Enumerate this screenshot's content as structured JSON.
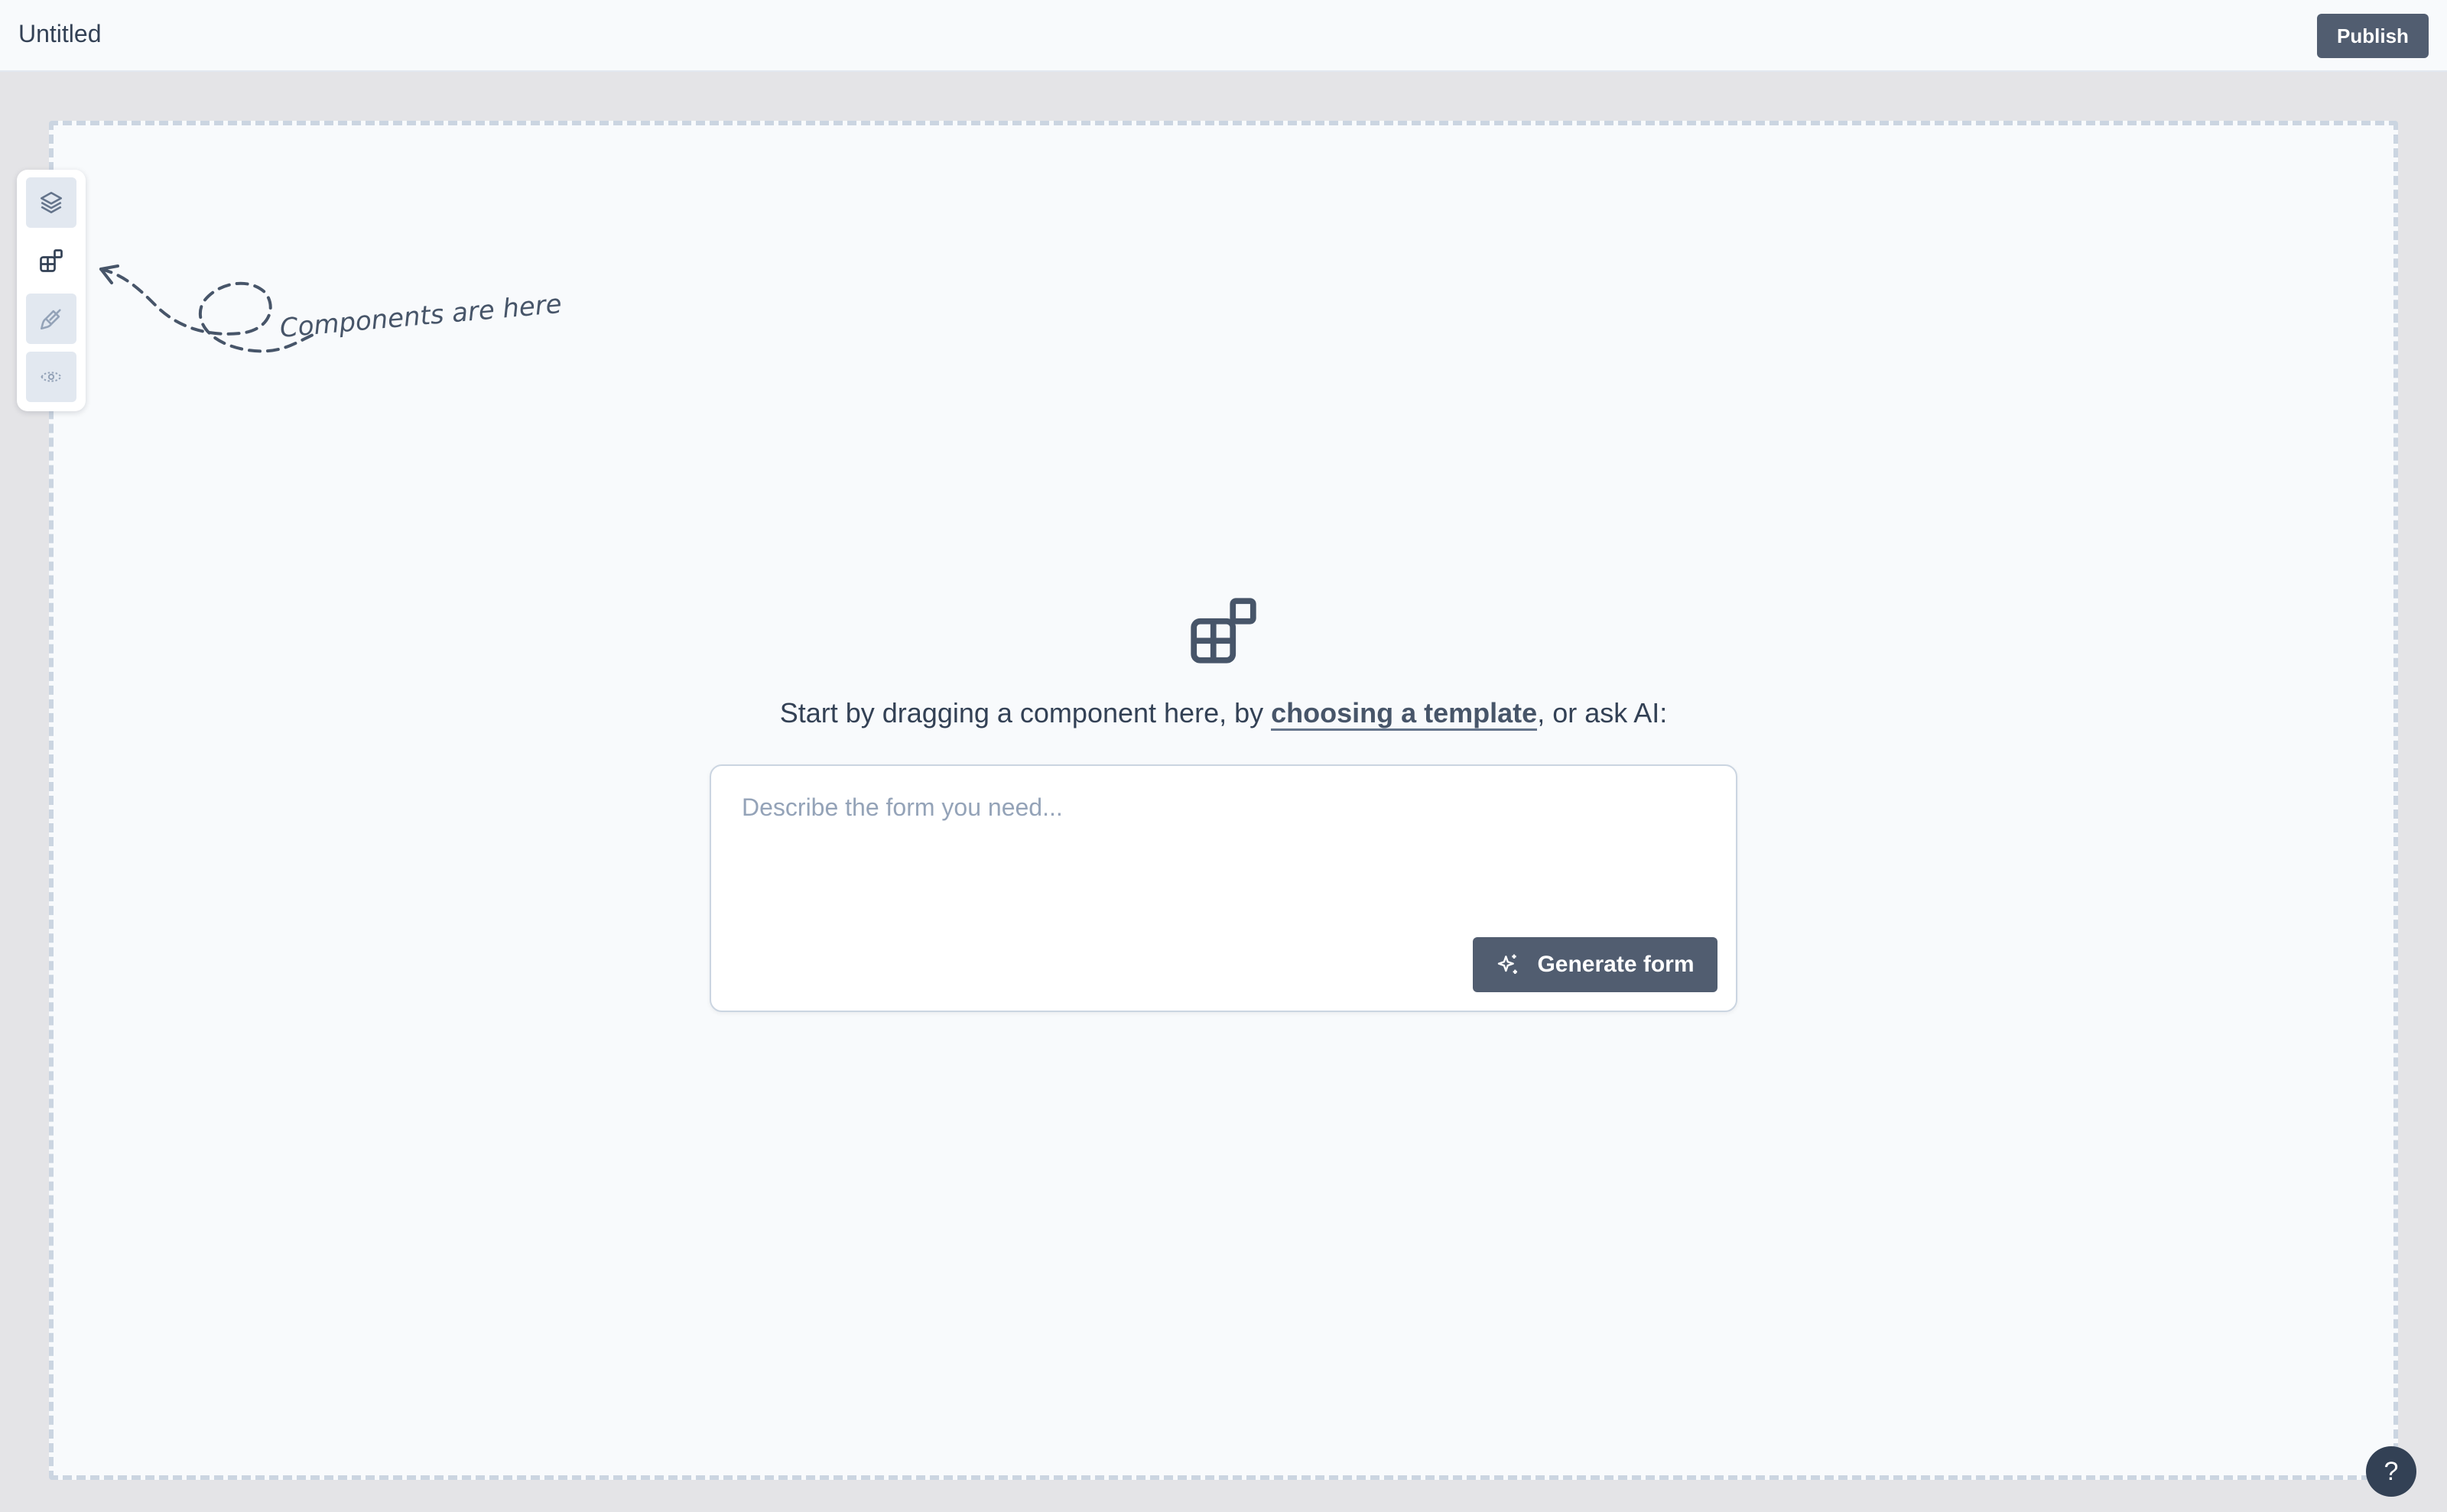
{
  "header": {
    "title": "Untitled",
    "publish_label": "Publish"
  },
  "toolbar": {
    "items": [
      {
        "name": "layers",
        "icon": "layers-icon"
      },
      {
        "name": "components",
        "icon": "components-icon"
      },
      {
        "name": "style",
        "icon": "brush-icon"
      },
      {
        "name": "preview",
        "icon": "eye-icon"
      }
    ]
  },
  "hint": {
    "text": "Components are here"
  },
  "empty_state": {
    "icon": "components-icon",
    "prompt_before": "Start by dragging a component here, by ",
    "template_link": "choosing a template",
    "prompt_after": ", or ask AI:"
  },
  "ai_form": {
    "placeholder": "Describe the form you need...",
    "value": "",
    "generate_label": "Generate form",
    "generate_icon": "sparkles-icon"
  },
  "help": {
    "label": "?"
  },
  "colors": {
    "primary": "#515d70",
    "canvas_bg": "#f8fafc",
    "outer_bg": "#e4e4e7",
    "dashed_border": "#cbd5e1",
    "text": "#334155"
  }
}
